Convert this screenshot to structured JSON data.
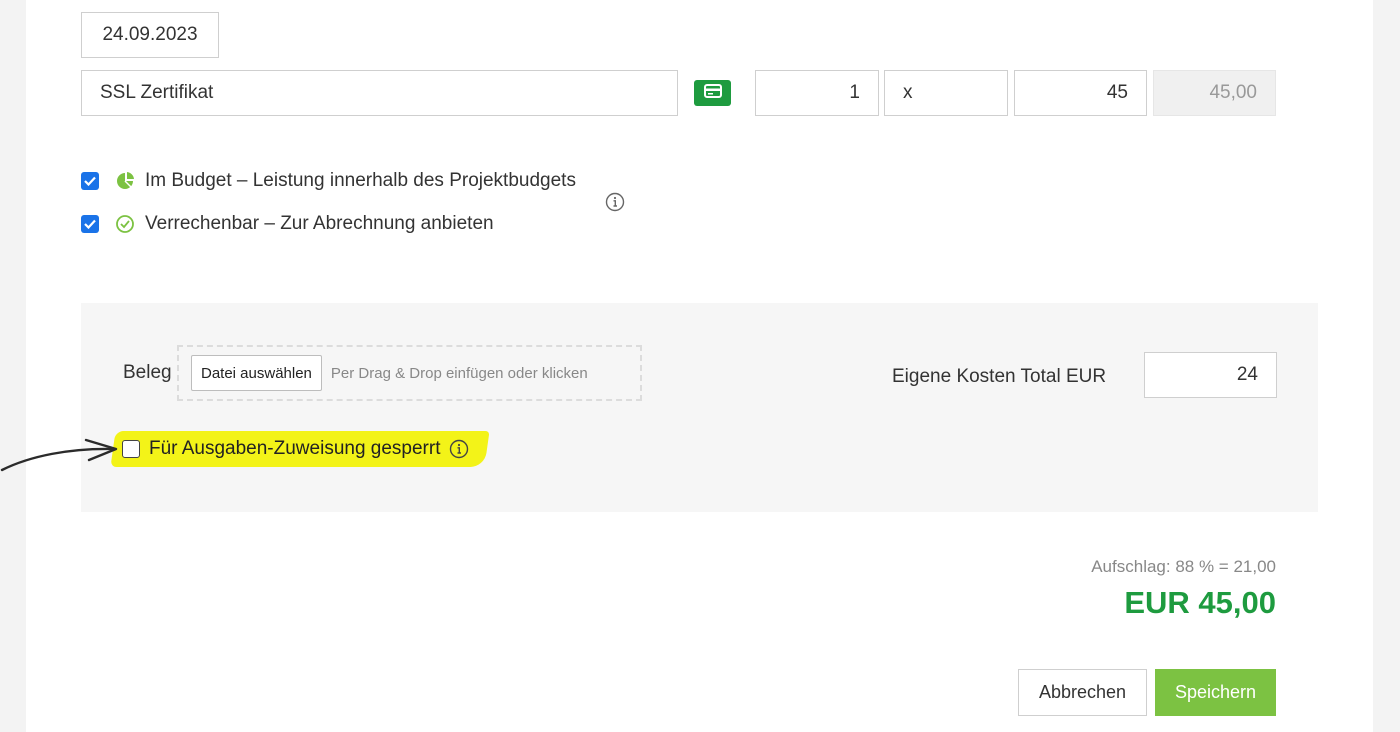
{
  "entry": {
    "date": "24.09.2023",
    "title": "SSL Zertifikat",
    "quantity": "1",
    "multiplier": "x",
    "unit_price": "45",
    "line_total": "45,00"
  },
  "options": {
    "budget_label": "Im Budget – Leistung innerhalb des Projektbudgets",
    "budget_checked": true,
    "billable_label": "Verrechenbar – Zur Abrechnung anbieten",
    "billable_checked": true
  },
  "receipt": {
    "label": "Beleg",
    "file_button": "Datei auswählen",
    "drop_hint": "Per Drag & Drop einfügen oder klicken",
    "own_costs_label": "Eigene Kosten Total EUR",
    "own_costs_value": "24",
    "lock_label": "Für Ausgaben-Zuweisung gesperrt",
    "lock_checked": false
  },
  "summary": {
    "surcharge": "Aufschlag: 88 % = 21,00",
    "total": "EUR 45,00"
  },
  "actions": {
    "cancel": "Abbrechen",
    "save": "Speichern"
  },
  "colors": {
    "accent_green": "#1e9b3f",
    "save_green": "#7cc242",
    "checkbox_blue": "#1a73e8",
    "highlight_yellow": "#f3f318"
  },
  "icons": [
    "credit-card-icon",
    "pie-chart-icon",
    "check-circle-icon",
    "info-icon",
    "arrow-annotation"
  ]
}
